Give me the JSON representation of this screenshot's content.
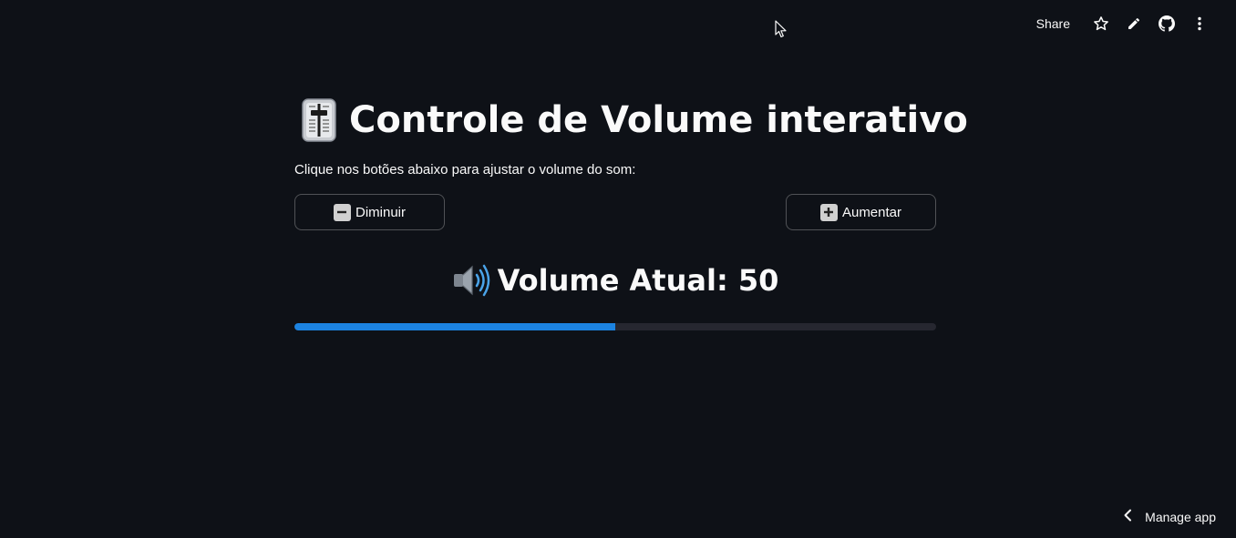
{
  "toolbar": {
    "share_label": "Share",
    "icons": [
      "star-icon",
      "pencil-icon",
      "github-icon",
      "kebab-menu-icon"
    ]
  },
  "main": {
    "title_emoji": "level-slider-icon",
    "title": "Controle de Volume interativo",
    "subtitle": "Clique nos botões abaixo para ajustar o volume do som:",
    "decrease_label": "Diminuir",
    "increase_label": "Aumentar",
    "volume_label": "Volume Atual: 50",
    "volume_value": 50,
    "volume_max": 100
  },
  "footer": {
    "manage_label": "Manage app"
  },
  "colors": {
    "background": "#0e1117",
    "text": "#fafafa",
    "progress_fill": "#1c83e1",
    "progress_track": "#262730"
  }
}
